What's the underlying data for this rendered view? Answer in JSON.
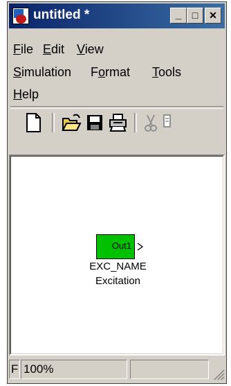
{
  "window": {
    "title": "untitled *",
    "minimize_glyph": "_",
    "maximize_glyph": "□",
    "close_glyph": "✕"
  },
  "menu": {
    "file": {
      "accel": "F",
      "rest": "ile"
    },
    "edit": {
      "accel": "E",
      "rest": "dit"
    },
    "view": {
      "accel": "V",
      "rest": "iew"
    },
    "simulation": {
      "accel": "S",
      "rest": "imulation"
    },
    "format": {
      "pre": "F",
      "accel": "o",
      "rest": "rmat"
    },
    "tools": {
      "accel": "T",
      "rest": "ools"
    },
    "help": {
      "accel": "H",
      "rest": "elp"
    }
  },
  "toolbar": {
    "icons": [
      "new-file-icon",
      "open-folder-icon",
      "save-icon",
      "print-icon",
      "cut-icon",
      "copy-icon"
    ]
  },
  "block": {
    "port_label": "Out1",
    "name": "EXC_NAME",
    "type_label": "Excitation",
    "fill_color": "#00c000"
  },
  "status": {
    "first": "F",
    "zoom": "100%"
  }
}
